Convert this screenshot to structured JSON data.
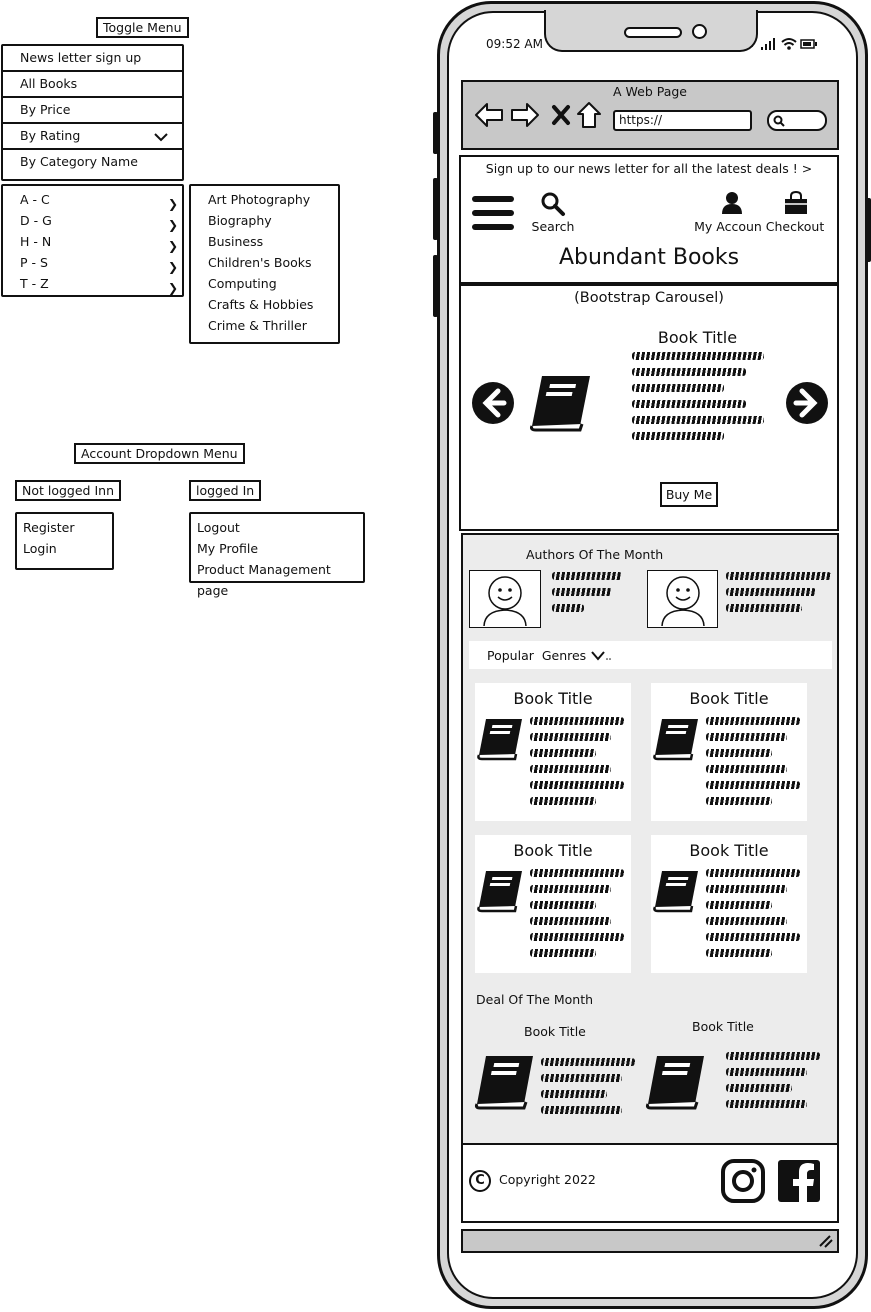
{
  "toggle_menu": {
    "label": "Toggle Menu",
    "items": [
      {
        "label": "News letter sign up"
      },
      {
        "label": "All Books"
      },
      {
        "label": "By Price"
      },
      {
        "label": "By Rating"
      },
      {
        "label": "By Category Name"
      }
    ],
    "rating_ranges": [
      "A - C",
      "D - G",
      "H - N",
      "P - S",
      "T - Z"
    ],
    "categories": [
      "Art Photography",
      "Biography",
      "Business",
      "Children's Books",
      "Computing",
      "Crafts & Hobbies",
      "Crime & Thriller"
    ]
  },
  "account_menu": {
    "label": "Account Dropdown Menu",
    "not_logged_in": {
      "label": "Not logged Inn",
      "items": [
        "Register",
        "Login"
      ]
    },
    "logged_in": {
      "label": "logged In",
      "items": [
        "Logout",
        "My Profile",
        "Product Management page"
      ]
    }
  },
  "phone": {
    "status_time": "09:52 AM",
    "browser": {
      "title": "A Web Page",
      "url": "https://"
    },
    "banner": "Sign up to our news letter for all the latest deals !  >",
    "nav": {
      "search": "Search",
      "account": "My Accoun",
      "checkout": "Checkout"
    },
    "site_title": "Abundant Books",
    "carousel": {
      "heading": "(Bootstrap Carousel)",
      "book_title": "Book Title",
      "buy_label": "Buy Me"
    },
    "authors_heading": "Authors Of The Month",
    "genres_label": "Popular  Genres",
    "books": [
      "Book Title",
      "Book Title",
      "Book Title",
      "Book Title"
    ],
    "deal_heading": "Deal Of The Month",
    "deals": [
      "Book Title",
      "Book Title"
    ],
    "footer_copyright": "Copyright 2022"
  }
}
